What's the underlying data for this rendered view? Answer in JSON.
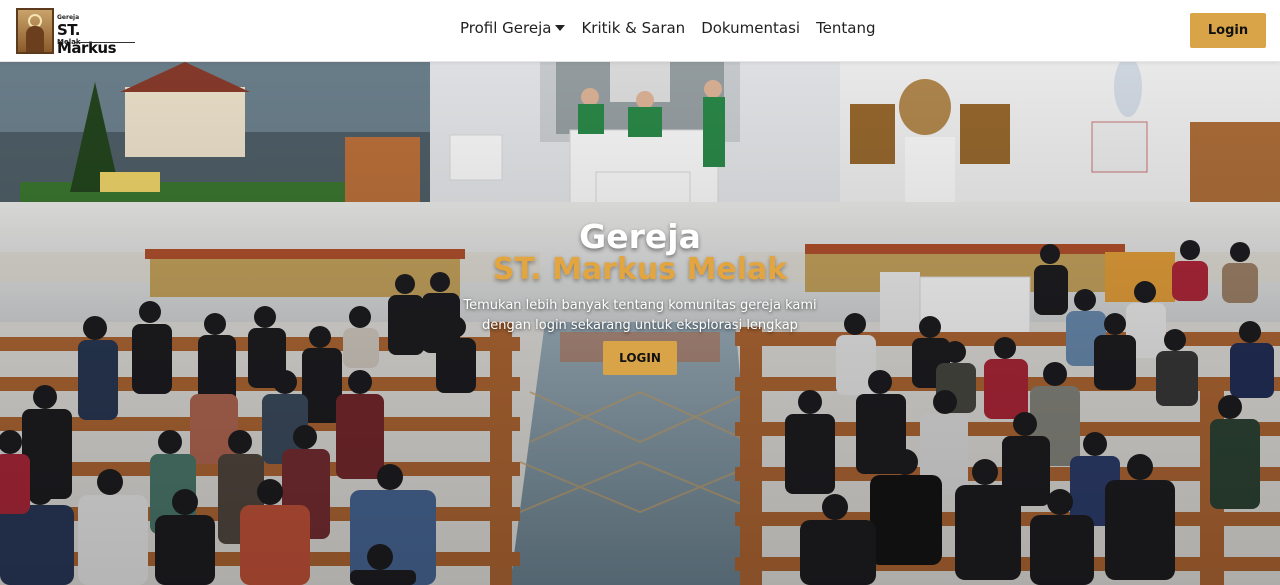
{
  "brand": {
    "top_text": "Gereja",
    "main_text": "ST. Markus",
    "bottom_text": "Melak"
  },
  "nav": {
    "items": [
      {
        "label": "Profil Gereja",
        "has_dropdown": true
      },
      {
        "label": "Kritik & Saran",
        "has_dropdown": false
      },
      {
        "label": "Dokumentasi",
        "has_dropdown": false
      },
      {
        "label": "Tentang",
        "has_dropdown": false
      }
    ],
    "login_label": "Login"
  },
  "hero": {
    "title_line1": "Gereja",
    "title_line2": "ST. Markus Melak",
    "subtitle_line1": "Temukan lebih banyak tentang komunitas gereja kami",
    "subtitle_line2": "dengan login sekarang untuk eksplorasi lengkap",
    "button_label": "LOGIN"
  },
  "colors": {
    "accent": "#d9a448",
    "title_gold": "#e3a53f",
    "nav_text": "#222222"
  }
}
